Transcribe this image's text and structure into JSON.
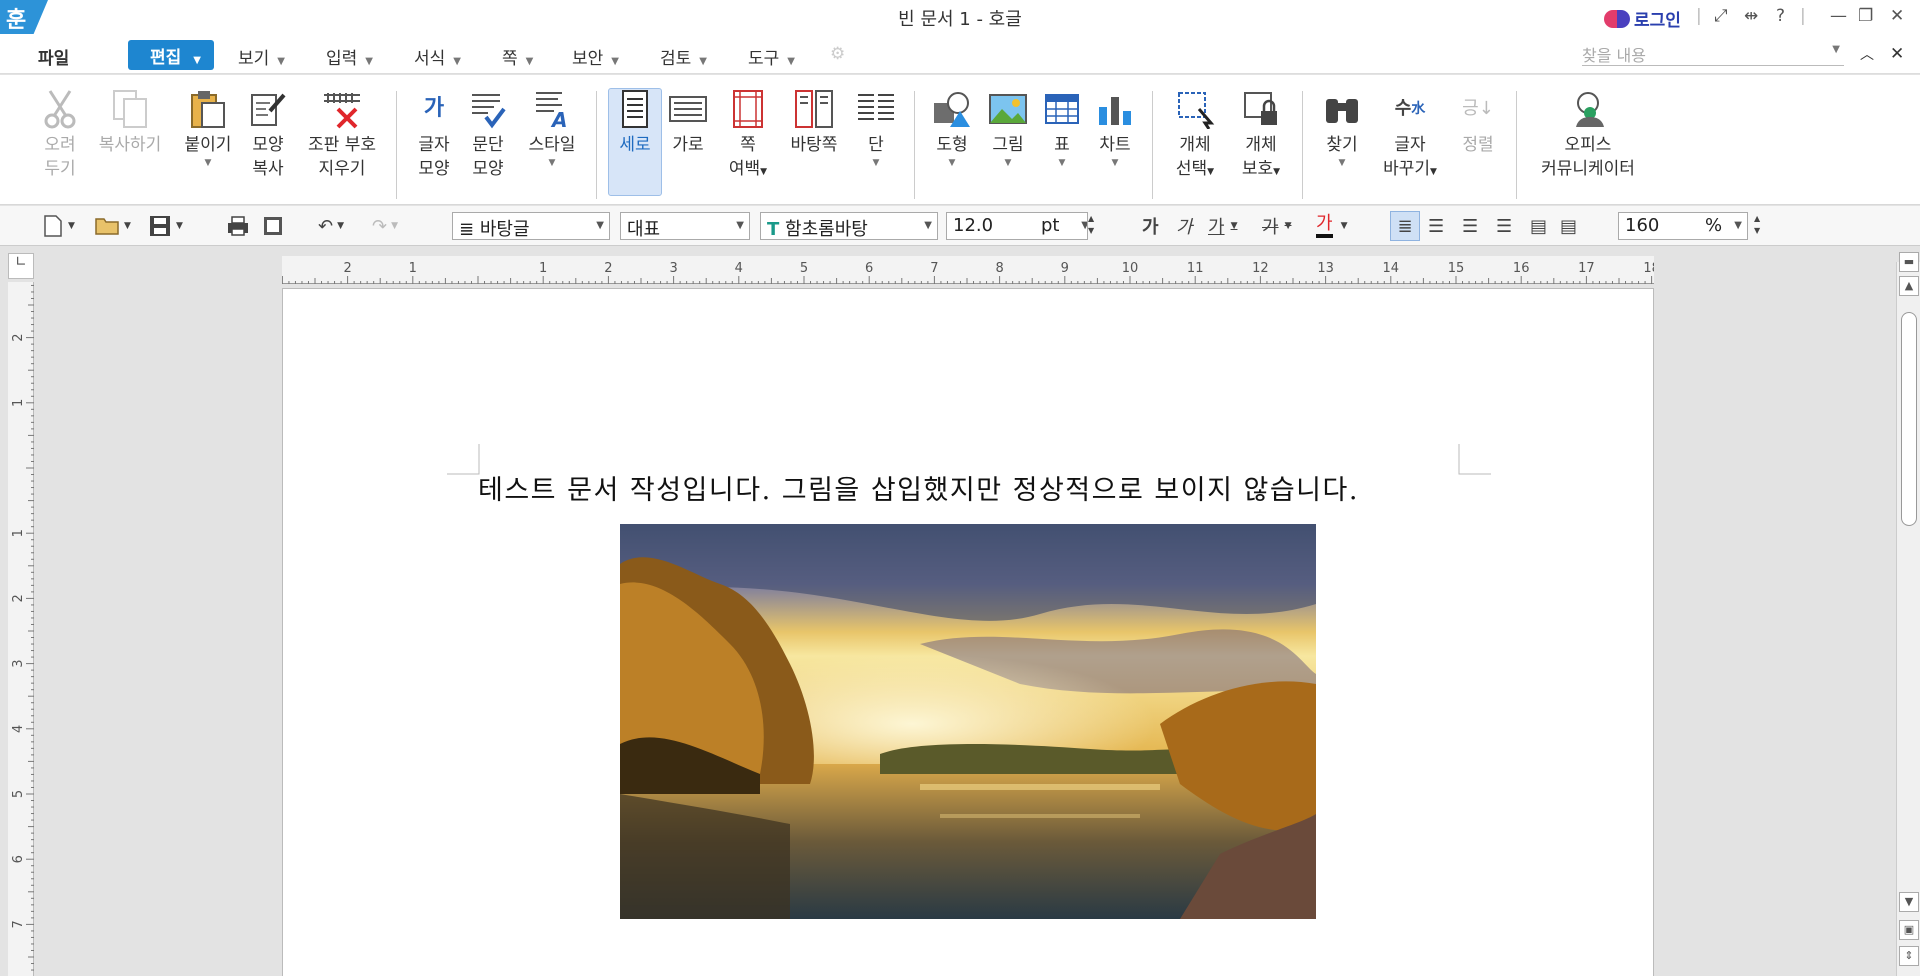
{
  "app": {
    "logo": "훈",
    "title": "빈 문서 1 - 호글",
    "login": "로그인"
  },
  "menu": {
    "file": "파일",
    "edit": "편집",
    "items": [
      "보기",
      "입력",
      "서식",
      "쪽",
      "보안",
      "검토",
      "도구"
    ],
    "search_placeholder": "찾을 내용"
  },
  "ribbon": {
    "cut": [
      "오려",
      "두기"
    ],
    "copy": "복사하기",
    "paste": "붙이기",
    "format_copy": [
      "모양",
      "복사"
    ],
    "clear_format": [
      "조판 부호",
      "지우기"
    ],
    "char_shape": [
      "글자",
      "모양"
    ],
    "para_shape": [
      "문단",
      "모양"
    ],
    "style": "스타일",
    "portrait": "세로",
    "landscape": "가로",
    "margin": [
      "쪽",
      "여백"
    ],
    "master": "바탕쪽",
    "columns": "단",
    "shape": "도형",
    "picture": "그림",
    "table": "표",
    "chart": "차트",
    "obj_select": [
      "개체",
      "선택"
    ],
    "obj_protect": [
      "개체",
      "보호"
    ],
    "find": "찾기",
    "replace": [
      "글자",
      "바꾸기"
    ],
    "sort": "정렬",
    "office": [
      "오피스",
      "커뮤니케이터"
    ]
  },
  "toolbar": {
    "para_style": "바탕글",
    "lang": "대표",
    "font": "함초롬바탕",
    "size": "12.0",
    "unit": "pt",
    "zoom": "160",
    "zoom_unit": "%",
    "bold": "가",
    "italic": "가",
    "underline": "가",
    "strike": "가",
    "color": "가"
  },
  "ruler": {
    "h_ticks": [
      "2",
      "1",
      "1",
      "2",
      "3",
      "4",
      "5",
      "6",
      "7",
      "8",
      "9",
      "10",
      "11",
      "12",
      "13",
      "14",
      "15",
      "16",
      "17",
      "18"
    ],
    "v_ticks": [
      "2",
      "1",
      "1",
      "2",
      "3",
      "4",
      "5",
      "6",
      "7"
    ]
  },
  "document": {
    "text": "테스트 문서 작성입니다. 그림을 삽입했지만 정상적으로 보이지 않습니다."
  },
  "colors": {
    "accent": "#1e86d0",
    "selected": "#d7e5f8"
  }
}
